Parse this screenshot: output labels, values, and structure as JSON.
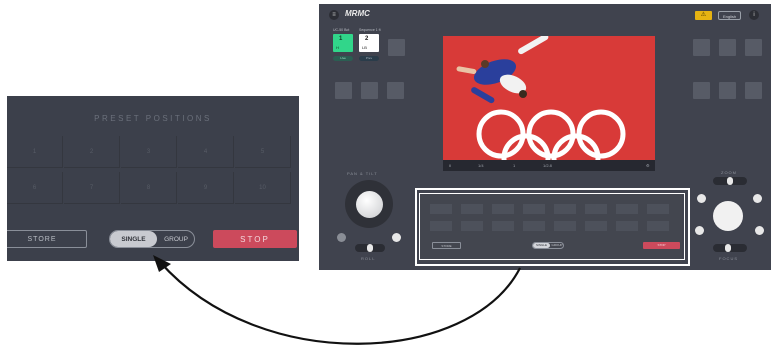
{
  "inset": {
    "title": "PRESET POSITIONS",
    "row1": [
      "1",
      "2",
      "3",
      "4",
      "5"
    ],
    "row2": [
      "6",
      "7",
      "8",
      "9",
      "10"
    ],
    "store_label": "STORE",
    "single_label": "SINGLE",
    "group_label": "GROUP",
    "stop_label": "STOP"
  },
  "app": {
    "title": "MRMC",
    "language_label": "English",
    "cameras": [
      {
        "label": "UC-50 Bot",
        "number": "1",
        "sub": "H",
        "pill": "Live",
        "color": "#31d68a"
      },
      {
        "label": "Sequence 1 ft",
        "number": "2",
        "sub": "LB",
        "pill": "Prev",
        "color": "#ffffff"
      }
    ],
    "video_bar": [
      "II",
      "1/4",
      "1",
      "1/2.8"
    ],
    "labels": {
      "pan_tilt": "PAN & TILT",
      "roll": "ROLL",
      "zoom": "ZOOM",
      "focus": "FOCUS"
    },
    "panel": {
      "store_label": "STORE",
      "single_label": "SINGLE",
      "group_label": "GROUP",
      "stop_label": "STOP"
    }
  },
  "colors": {
    "accent_stop": "#cc4a5c",
    "camera_live": "#31d68a",
    "warning": "#e6b312",
    "mat_red": "#d83a38"
  }
}
